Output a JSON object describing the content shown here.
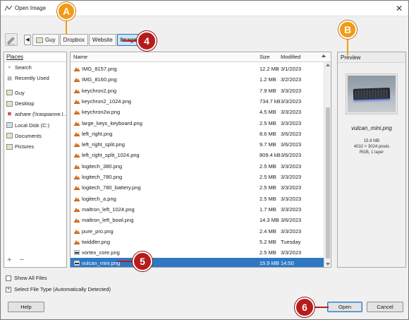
{
  "window": {
    "title": "Open Image",
    "close_glyph": "✕"
  },
  "toolbar": {
    "nav_back_glyph": "◀",
    "breadcrumbs": [
      {
        "label": "Guy",
        "has_icon": true,
        "active": false
      },
      {
        "label": "Dropbox",
        "has_icon": false,
        "active": false
      },
      {
        "label": "Website",
        "has_icon": false,
        "active": false
      },
      {
        "label": "Images",
        "has_icon": false,
        "active": true
      }
    ]
  },
  "places": {
    "header": "Places",
    "items": [
      {
        "label": "Search",
        "icon": "search-icon"
      },
      {
        "label": "Recently Used",
        "icon": "recent-icon"
      },
      {
        "label": "Guy",
        "icon": "folder-icon"
      },
      {
        "label": "Desktop",
        "icon": "folder-icon"
      },
      {
        "label": "ashare (\\\\raspianne.l...",
        "icon": "network-drive-icon"
      },
      {
        "label": "Local Disk (C:)",
        "icon": "drive-icon"
      },
      {
        "label": "Documents",
        "icon": "folder-icon"
      },
      {
        "label": "Pictures",
        "icon": "folder-icon"
      }
    ],
    "add_glyph": "+",
    "remove_glyph": "−"
  },
  "file_list": {
    "columns": {
      "name": "Name",
      "size": "Size",
      "modified": "Modified"
    },
    "rows": [
      {
        "name": "IMG_8157.png",
        "size": "12.2 MB",
        "modified": "3/1/2023",
        "icon": "image-file-icon"
      },
      {
        "name": "IMG_8160.png",
        "size": "1.2 MB",
        "modified": "3/2/2023",
        "icon": "image-file-icon"
      },
      {
        "name": "keychron2.png",
        "size": "7.9 MB",
        "modified": "3/3/2023",
        "icon": "image-file-icon"
      },
      {
        "name": "keychron2_1024.png",
        "size": "734.7 kB",
        "modified": "3/3/2023",
        "icon": "image-file-icon"
      },
      {
        "name": "keychron2w.png",
        "size": "4.5 MB",
        "modified": "3/3/2023",
        "icon": "image-file-icon"
      },
      {
        "name": "large_keys_keyboard.png",
        "size": "2.5 MB",
        "modified": "3/3/2023",
        "icon": "image-file-icon"
      },
      {
        "name": "left_right.png",
        "size": "8.6 MB",
        "modified": "3/6/2023",
        "icon": "image-file-icon"
      },
      {
        "name": "left_right_split.png",
        "size": "9.7 MB",
        "modified": "3/6/2023",
        "icon": "image-file-icon"
      },
      {
        "name": "left_right_split_1024.png",
        "size": "809.4 kB",
        "modified": "3/6/2023",
        "icon": "image-file-icon"
      },
      {
        "name": "logitech_380.png",
        "size": "2.5 MB",
        "modified": "3/3/2023",
        "icon": "image-file-icon"
      },
      {
        "name": "logitech_780.png",
        "size": "2.5 MB",
        "modified": "3/3/2023",
        "icon": "image-file-icon"
      },
      {
        "name": "logitech_780_battery.png",
        "size": "2.5 MB",
        "modified": "3/3/2023",
        "icon": "image-file-icon"
      },
      {
        "name": "logitech_a.png",
        "size": "2.5 MB",
        "modified": "3/3/2023",
        "icon": "image-file-icon"
      },
      {
        "name": "maltron_left_1024.png",
        "size": "1.7 MB",
        "modified": "3/3/2023",
        "icon": "image-file-icon"
      },
      {
        "name": "maltron_left_bowl.png",
        "size": "14.3 MB",
        "modified": "3/6/2023",
        "icon": "image-file-icon"
      },
      {
        "name": "pure_pro.png",
        "size": "2.4 MB",
        "modified": "3/3/2023",
        "icon": "image-file-icon"
      },
      {
        "name": "twiddler.png",
        "size": "5.2 MB",
        "modified": "Tuesday",
        "icon": "image-file-icon"
      },
      {
        "name": "vortex_core.png",
        "size": "2.5 MB",
        "modified": "3/3/2023",
        "icon": "image-thumb-icon"
      },
      {
        "name": "vulcan_mini.png",
        "size": "15.9 MB",
        "modified": "14:50",
        "icon": "image-thumb-icon",
        "selected": true
      }
    ]
  },
  "preview": {
    "header": "Preview",
    "filename": "vulcan_mini.png",
    "size": "15.9 MB",
    "dimensions": "4032 × 3024 pixels",
    "mode": "RGB, 1 layer"
  },
  "options": {
    "show_all_files": "Show All Files",
    "select_file_type": "Select File Type (Automatically Detected)"
  },
  "buttons": {
    "help": "Help",
    "open": "Open",
    "cancel": "Cancel"
  },
  "callouts": {
    "a": "A",
    "b": "B",
    "four": "4",
    "five": "5",
    "six": "6"
  },
  "colors": {
    "selection": "#2f78c4",
    "callout_red": "#b71c1c",
    "callout_orange": "#f29a16"
  }
}
